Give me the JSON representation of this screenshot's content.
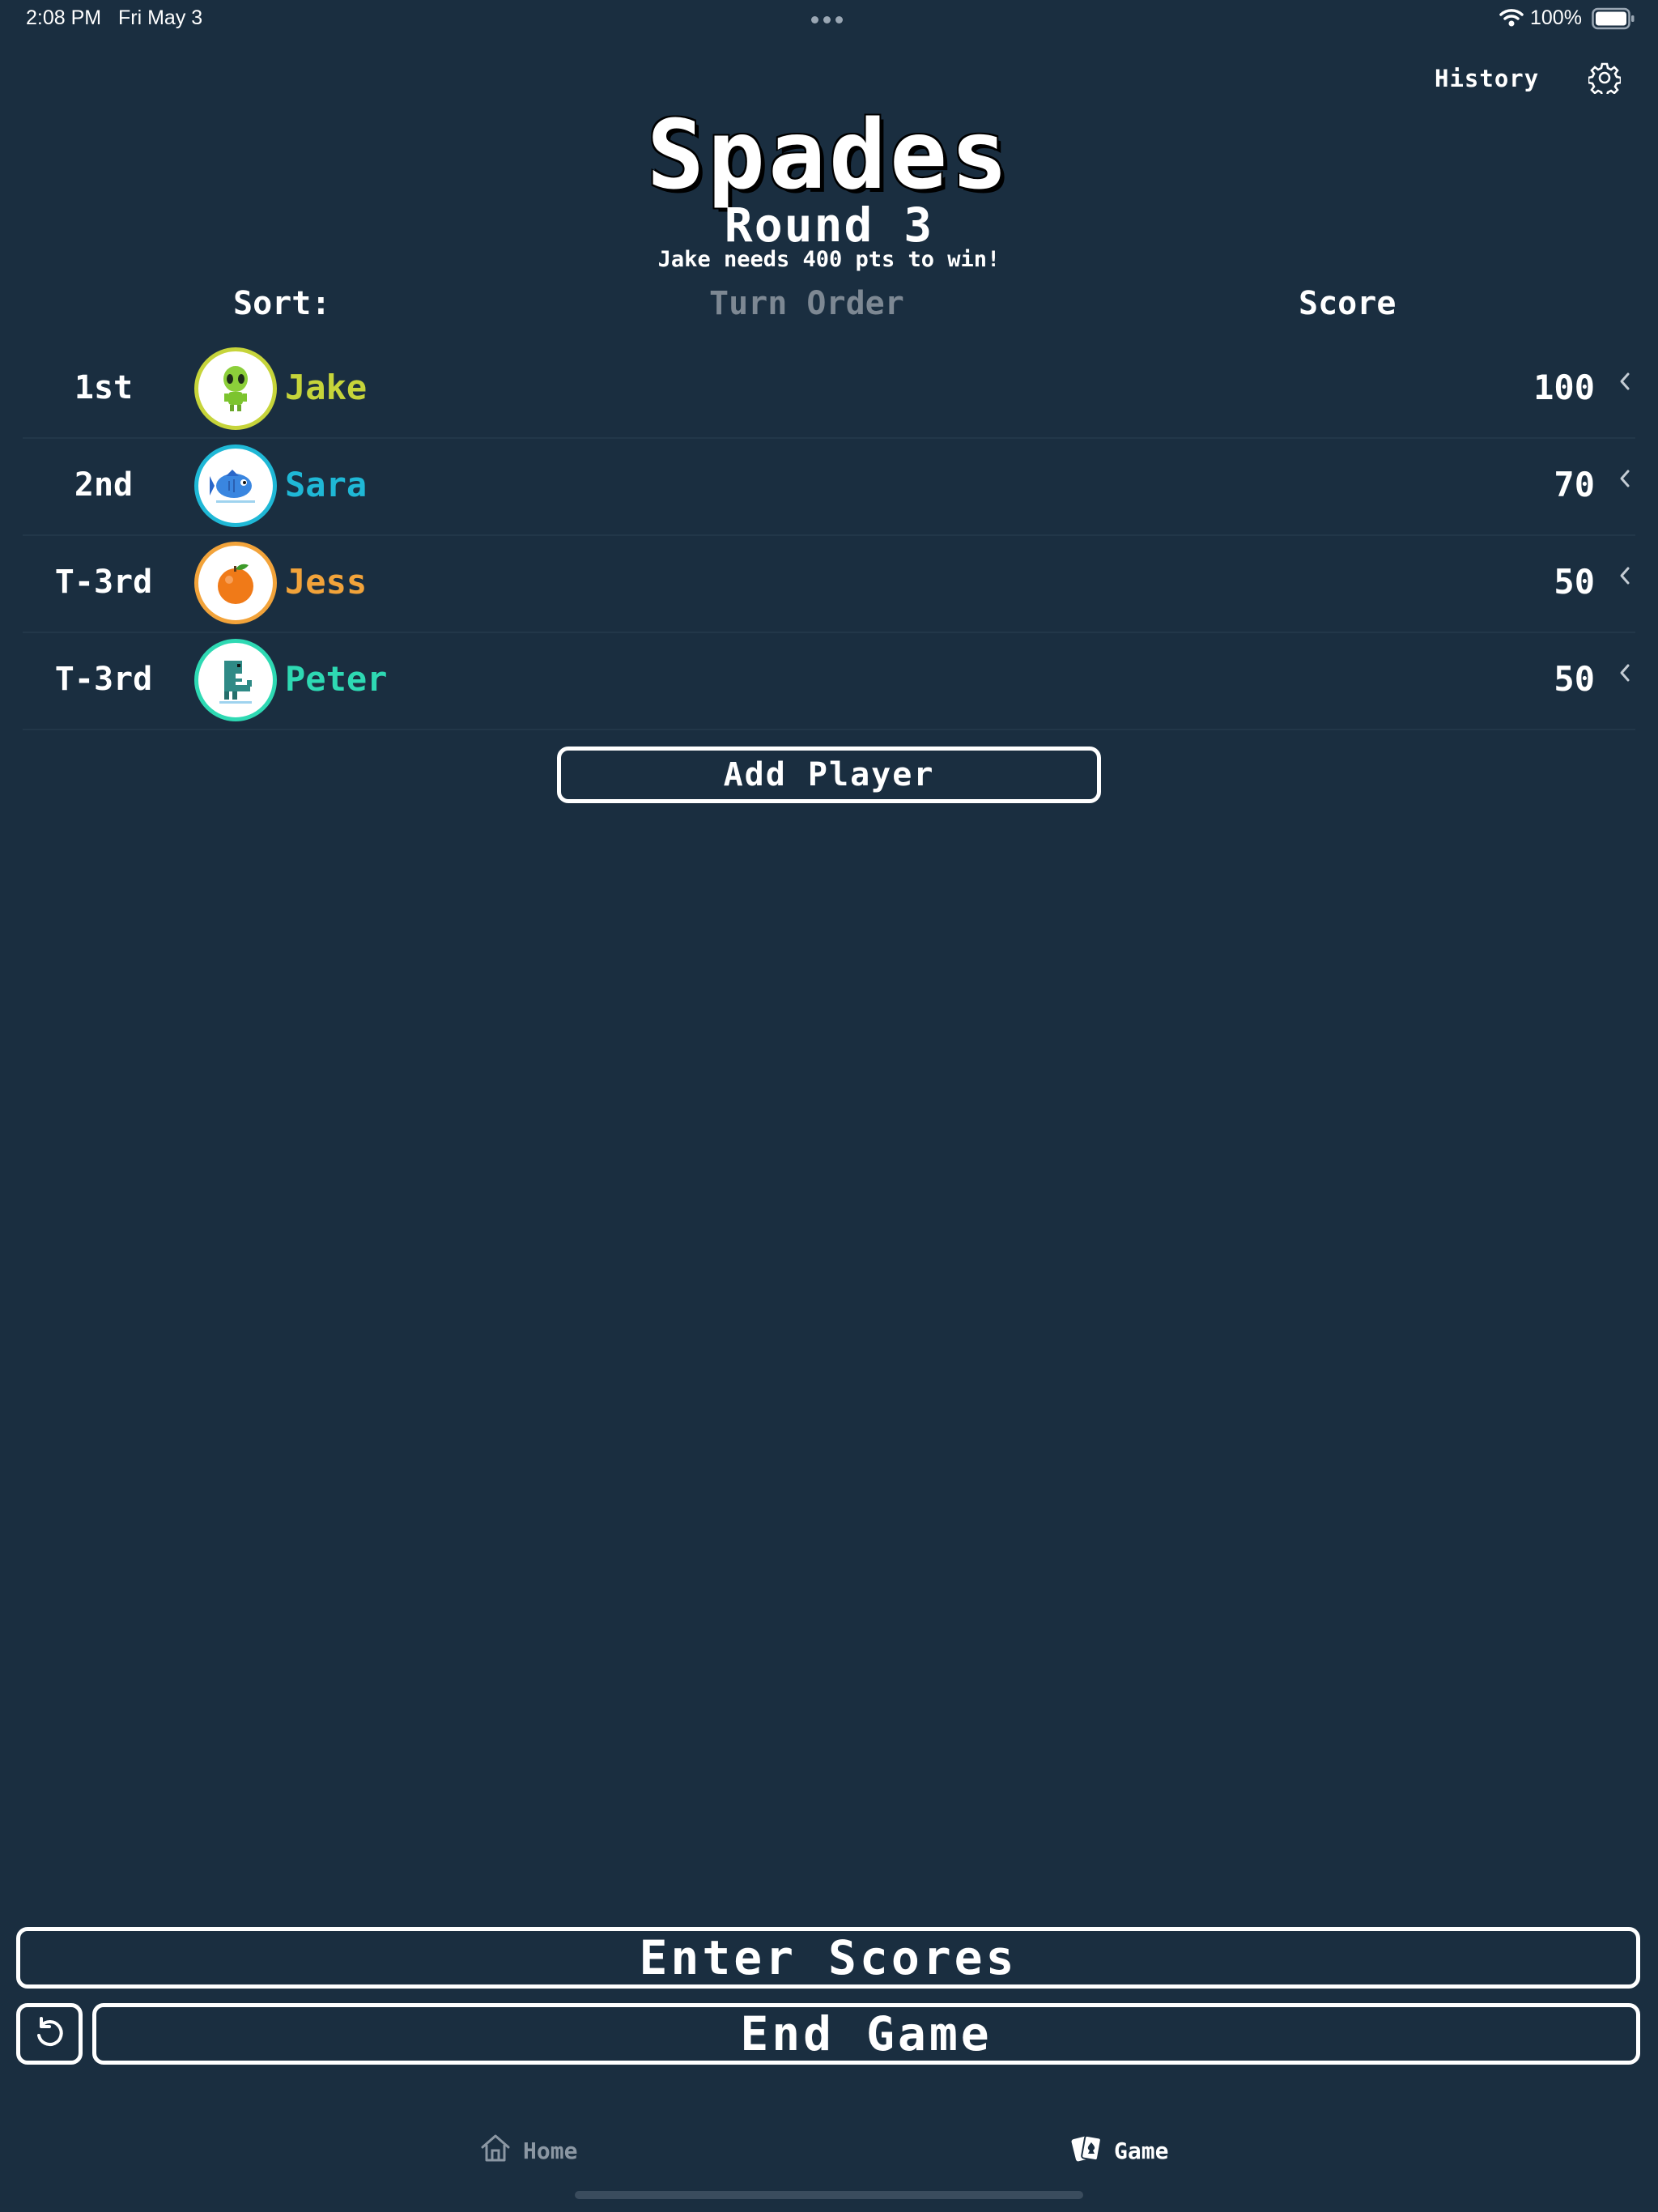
{
  "status_bar": {
    "time": "2:08 PM",
    "date": "Fri May 3",
    "battery": "100%"
  },
  "header": {
    "history_label": "History",
    "settings_icon": "gear-icon"
  },
  "game": {
    "title": "Spades",
    "round": "Round 3",
    "win_note": "Jake needs 400 pts to win!"
  },
  "sort": {
    "label": "Sort:",
    "options": [
      "Turn Order",
      "Score"
    ],
    "selected": "Score"
  },
  "players": [
    {
      "rank": "1st",
      "name": "Jake",
      "score": "100",
      "color": "#c6d43a",
      "avatar": "alien"
    },
    {
      "rank": "2nd",
      "name": "Sara",
      "score": "70",
      "color": "#1fb8d6",
      "avatar": "fish"
    },
    {
      "rank": "T-3rd",
      "name": "Jess",
      "score": "50",
      "color": "#f2a33a",
      "avatar": "orange"
    },
    {
      "rank": "T-3rd",
      "name": "Peter",
      "score": "50",
      "color": "#2ed9b3",
      "avatar": "dinosaur"
    }
  ],
  "actions": {
    "add_player": "Add Player",
    "enter_scores": "Enter Scores",
    "end_game": "End Game",
    "undo_icon": "undo-icon"
  },
  "tab_bar": {
    "home": "Home",
    "game": "Game",
    "active": "Game"
  },
  "colors": {
    "background": "#1a2e40",
    "text": "#ffffff",
    "muted": "#7d8893"
  }
}
